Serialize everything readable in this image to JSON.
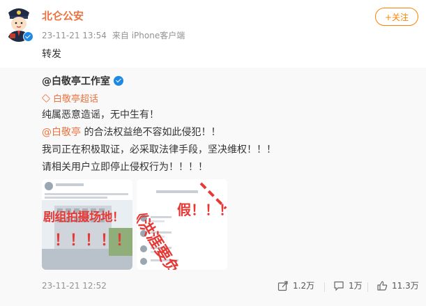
{
  "post": {
    "author": "北仑公安",
    "time": "23-11-21 13:54",
    "source": "来自 iPhone客户端",
    "text": "转发",
    "follow_label": "+关注"
  },
  "repost": {
    "author": "@白敬亭工作室",
    "topic": "白敬亭超话",
    "line1": "纯属恶意造谣，无中生有！",
    "mention": "@白敬亭",
    "line2_rest": " 的合法权益绝不容如此侵犯！！",
    "line3": "我司正在积极取证，必采取法律手段，坚决维权！！！",
    "line4": "请相关用户立即停止侵权行为！！！！",
    "image1": {
      "overlay_text": "剧组拍摄场地！",
      "exclaims": "！！！！！"
    },
    "image2": {
      "overlay_text": "《洪涯要负",
      "fake_text": "假！！！"
    },
    "time": "23-11-21 12:52",
    "actions": {
      "forwards": "1.2万",
      "comments": "1万",
      "likes": "11.3万"
    }
  },
  "colors": {
    "accent": "#eb7340",
    "follow": "#ff8200",
    "link_blue": "#1e88e5",
    "overlay_red": "#e53935"
  },
  "icons": [
    "verified-icon",
    "supertopic-icon",
    "forward-icon",
    "comment-icon",
    "like-icon"
  ]
}
